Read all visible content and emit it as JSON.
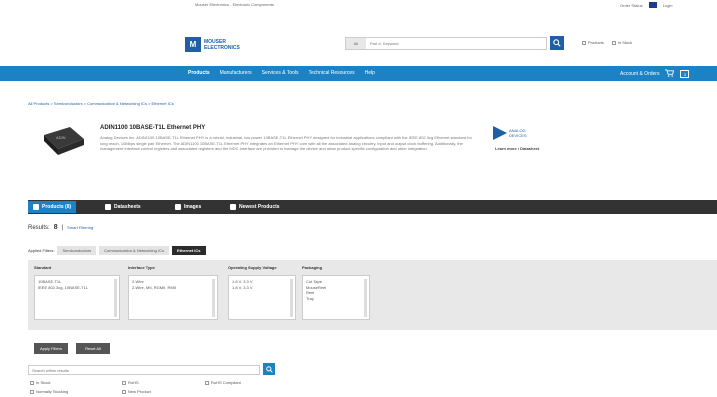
{
  "topbar": {
    "utility_text": "Mouser Electronics - Electronic Components",
    "right_links": [
      "Order Status",
      "Login"
    ]
  },
  "header": {
    "logo_text_line1": "MOUSER",
    "logo_text_line2": "ELECTRONICS",
    "search_category": "All",
    "search_placeholder": "Part #, Keyword",
    "option_products": "Products",
    "option_stock": "In Stock"
  },
  "nav": {
    "items": [
      "Products",
      "Manufacturers",
      "Services & Tools",
      "Technical Resources",
      "Help"
    ],
    "account": "Account & Orders",
    "cart_count": "0"
  },
  "breadcrumb": "All Products > Semiconductors > Communication & Networking ICs > Ethernet ICs",
  "product": {
    "title": "ADIN1100 10BASE-T1L Ethernet PHY",
    "description": "Analog Devices Inc. ADIN1100 10BASE-T1L Ethernet PHY is a robust, industrial, low power 10BASE-T1L Ethernet PHY designed for industrial applications compliant with the IEEE 802.3cg Ethernet standard for long reach, 10Mbps single pair Ethernet. The ADIN1100 10BASE-T1L Ethernet PHY integrates an Ethernet PHY core with all the associated analog circuitry, input and output clock buffering. Additionally, the management interface control registers and associated registers and the MDC Interface are provided to manage the device and allow product specific configuration and other integration.",
    "manufacturer_line1": "ANALOG",
    "manufacturer_line2": "DEVICES",
    "manufacturer_link": "Learn more / Datasheet"
  },
  "tabs": [
    {
      "label": "Products (8)"
    },
    {
      "label": "Datasheets"
    },
    {
      "label": "Images"
    },
    {
      "label": "Newest Products"
    }
  ],
  "results": {
    "label": "Results:",
    "count": "8",
    "clear_all": "Smart Filtering"
  },
  "applied_filters": {
    "label": "Applied Filters:",
    "pills": [
      "Semiconductors",
      "Communication & Networking ICs",
      "Ethernet ICs"
    ]
  },
  "filters": [
    {
      "header": "Standard",
      "options": [
        "10BASE-T1L",
        "IEEE 802.3cg, 10BASE-T1L"
      ]
    },
    {
      "header": "Interface Type",
      "options": [
        "2-Wire",
        "2-Wire, MII, RGMII, RMII"
      ]
    },
    {
      "header": "Operating Supply Voltage",
      "options": [
        "1.8 V, 3.3 V",
        "1.8 V, 3.3 V"
      ]
    },
    {
      "header": "Packaging",
      "options": [
        "Cut Tape",
        "MouseReel",
        "Reel",
        "Tray"
      ]
    }
  ],
  "actions": {
    "apply": "Apply Filters",
    "reset": "Reset All"
  },
  "part_search": {
    "placeholder": "Search within results",
    "options": [
      "In Stock",
      "Normally Stocking",
      "RoHS",
      "New Product",
      "RoHS Compliant"
    ]
  }
}
